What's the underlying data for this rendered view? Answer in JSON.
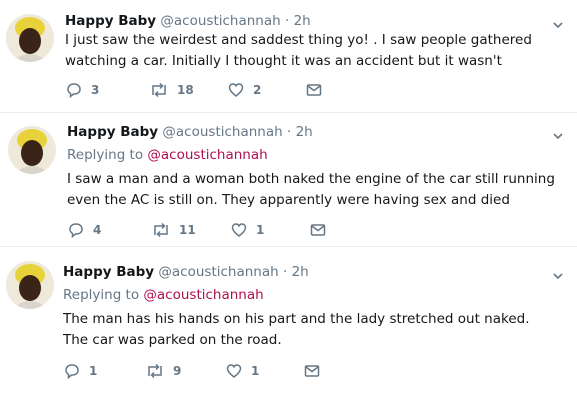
{
  "tweets": [
    {
      "name": "Happy Baby",
      "handle": "@acoustichannah",
      "dot": "·",
      "time": "2h",
      "replying_prefix": "",
      "replying_to": "",
      "text": "I just saw the weirdest and saddest thing yo! . I saw people gathered watching a car. Initially I thought it was an accident but it wasn't",
      "replies": "3",
      "retweets": "18",
      "likes": "2"
    },
    {
      "name": "Happy Baby",
      "handle": "@acoustichannah",
      "dot": "·",
      "time": "2h",
      "replying_prefix": "Replying to",
      "replying_to": "@acoustichannah",
      "text": "I saw a man and a woman both naked the engine of the car still running even the AC is still on. They apparently were having sex and died",
      "replies": "4",
      "retweets": "11",
      "likes": "1"
    },
    {
      "name": "Happy Baby",
      "handle": "@acoustichannah",
      "dot": "·",
      "time": "2h",
      "replying_prefix": "Replying to",
      "replying_to": "@acoustichannah",
      "text": "The man has his hands on his part and the lady stretched out naked. The car was parked on the road.",
      "replies": "1",
      "retweets": "9",
      "likes": "1"
    }
  ],
  "icons": {
    "reply": "reply-icon",
    "retweet": "retweet-icon",
    "like": "heart-icon",
    "message": "direct-message-icon",
    "caret": "chevron-down-icon"
  },
  "colors": {
    "text": "#14171a",
    "muted": "#657786",
    "mention": "#b0104f",
    "separator": "#e6ecf0"
  }
}
